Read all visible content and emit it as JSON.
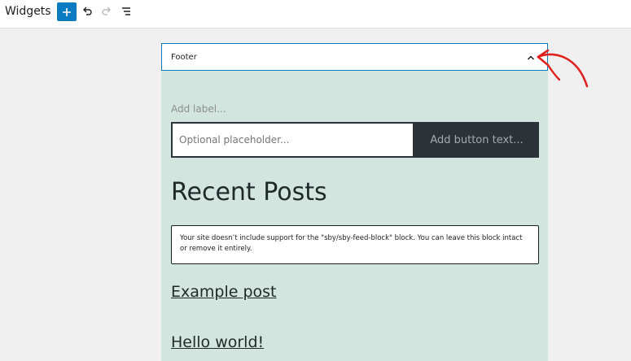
{
  "header": {
    "title": "Widgets",
    "add_icon": "plus-icon",
    "undo_icon": "undo-icon",
    "redo_icon": "redo-icon",
    "list_icon": "list-view-icon",
    "accent_color": "#0a7bc2"
  },
  "widget_area": {
    "title": "Footer",
    "toggle_icon": "chevron-up-icon",
    "background_color": "#d3e5df"
  },
  "annotation": {
    "icon": "arrow-annotation-icon",
    "color": "#e0221f"
  },
  "search_block": {
    "label": "Add label...",
    "placeholder": "Optional placeholder...",
    "button_text": "Add button text..."
  },
  "recent_posts": {
    "heading": "Recent Posts",
    "notice": "Your site doesn’t include support for the \"sby/sby-feed-block\" block. You can leave this block intact or remove it entirely.",
    "posts": [
      "Example post",
      "Hello world!"
    ]
  }
}
